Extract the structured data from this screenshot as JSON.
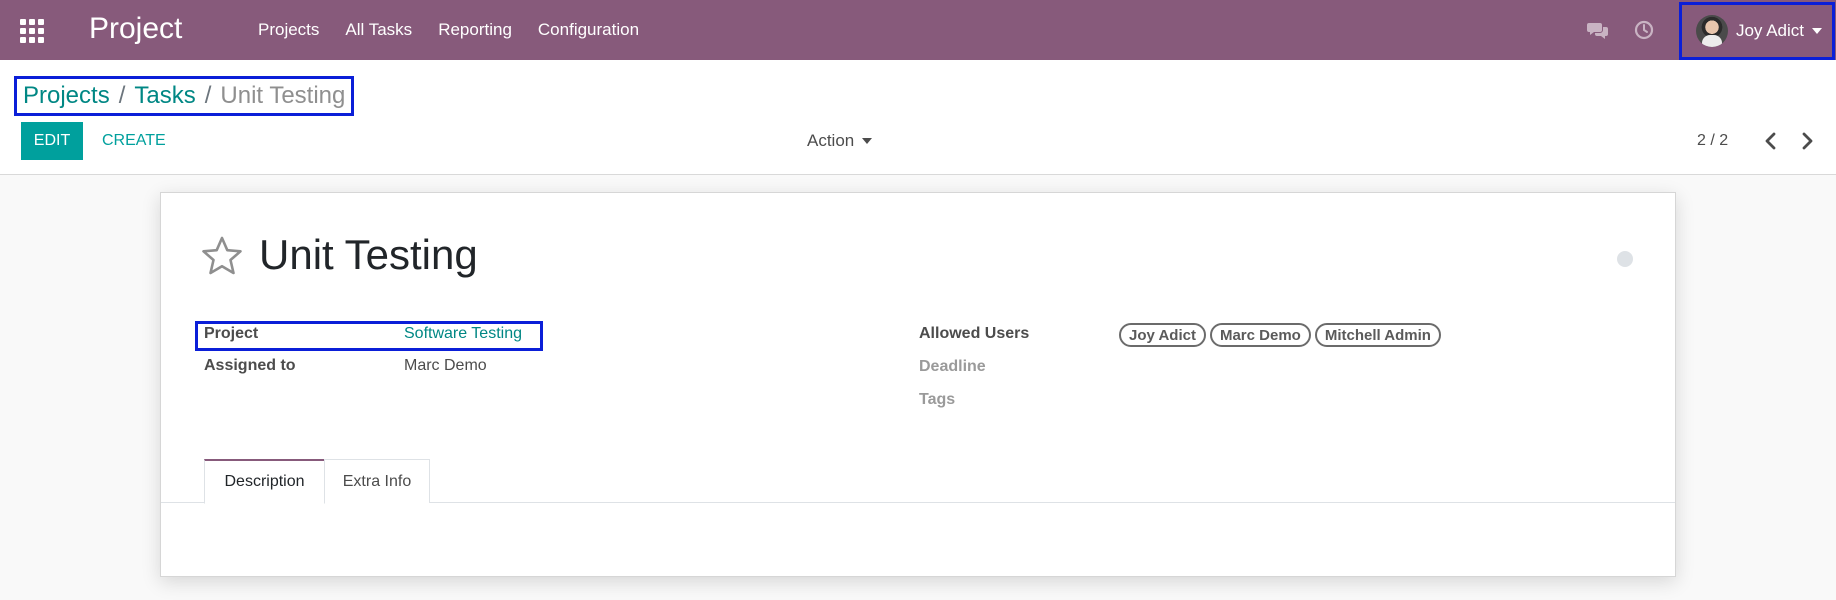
{
  "navbar": {
    "app_title": "Project",
    "menu": [
      "Projects",
      "All Tasks",
      "Reporting",
      "Configuration"
    ],
    "user_name": "Joy Adict",
    "brand_color": "#875a7b"
  },
  "breadcrumb": {
    "items": [
      "Projects",
      "Tasks"
    ],
    "current": "Unit Testing",
    "separator": "/"
  },
  "controls": {
    "edit_label": "EDIT",
    "create_label": "CREATE",
    "action_label": "Action",
    "pager": "2 / 2",
    "accent_color": "#00a09d"
  },
  "record": {
    "title": "Unit Testing",
    "fields": {
      "project_label": "Project",
      "project_value": "Software Testing",
      "assigned_label": "Assigned to",
      "assigned_value": "Marc Demo",
      "allowed_users_label": "Allowed Users",
      "allowed_users": [
        "Joy Adict",
        "Marc Demo",
        "Mitchell Admin"
      ],
      "deadline_label": "Deadline",
      "tags_label": "Tags"
    },
    "tabs": [
      "Description",
      "Extra Info"
    ]
  }
}
